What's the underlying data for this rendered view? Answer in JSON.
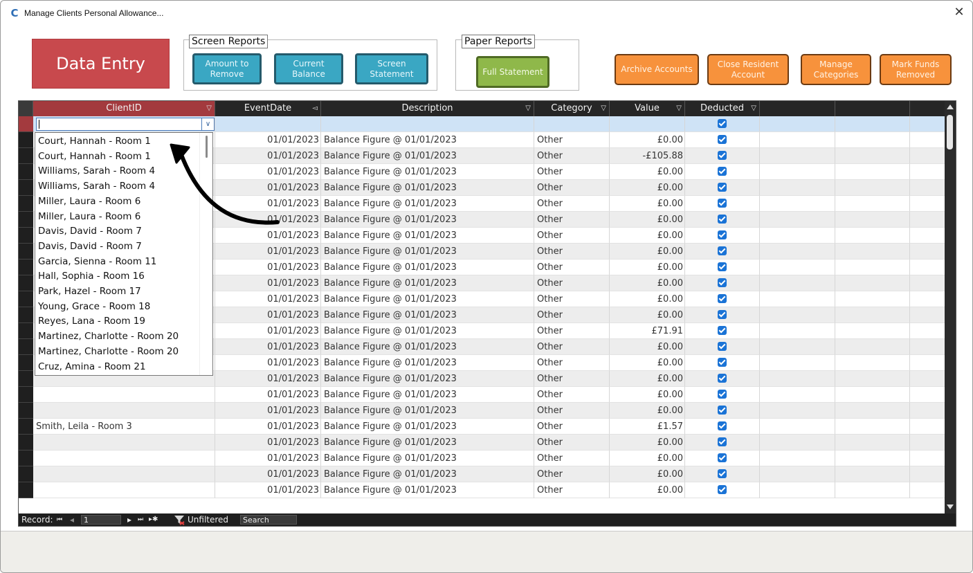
{
  "window": {
    "title": "Manage Clients Personal Allowance...",
    "close_glyph": "✕",
    "icon": "C"
  },
  "toolbar": {
    "data_entry": "Data Entry",
    "screen_reports_label": "Screen Reports",
    "amount_to_remove": "Amount to Remove",
    "current_balance": "Current Balance",
    "screen_statement": "Screen Statement",
    "paper_reports_label": "Paper Reports",
    "full_statement": "Full Statement",
    "archive_accounts": "Archive Accounts",
    "close_resident_account": "Close Resident Account",
    "manage_categories": "Manage Categories",
    "mark_funds_removed": "Mark Funds Removed"
  },
  "grid": {
    "columns": {
      "client": "ClientID",
      "date": "EventDate",
      "desc": "Description",
      "cat": "Category",
      "val": "Value",
      "ded": "Deducted"
    },
    "rows": [
      {
        "client": "",
        "date": "",
        "desc": "",
        "cat": "",
        "val": "",
        "ded": true
      },
      {
        "client": "",
        "date": "01/01/2023",
        "desc": "Balance Figure @ 01/01/2023",
        "cat": "Other",
        "val": "£0.00",
        "ded": true
      },
      {
        "client": "",
        "date": "01/01/2023",
        "desc": "Balance Figure @ 01/01/2023",
        "cat": "Other",
        "val": "-£105.88",
        "ded": true
      },
      {
        "client": "",
        "date": "01/01/2023",
        "desc": "Balance Figure @ 01/01/2023",
        "cat": "Other",
        "val": "£0.00",
        "ded": true
      },
      {
        "client": "",
        "date": "01/01/2023",
        "desc": "Balance Figure @ 01/01/2023",
        "cat": "Other",
        "val": "£0.00",
        "ded": true
      },
      {
        "client": "",
        "date": "01/01/2023",
        "desc": "Balance Figure @ 01/01/2023",
        "cat": "Other",
        "val": "£0.00",
        "ded": true
      },
      {
        "client": "",
        "date": "01/01/2023",
        "desc": "Balance Figure @ 01/01/2023",
        "cat": "Other",
        "val": "£0.00",
        "ded": true
      },
      {
        "client": "",
        "date": "01/01/2023",
        "desc": "Balance Figure @ 01/01/2023",
        "cat": "Other",
        "val": "£0.00",
        "ded": true
      },
      {
        "client": "",
        "date": "01/01/2023",
        "desc": "Balance Figure @ 01/01/2023",
        "cat": "Other",
        "val": "£0.00",
        "ded": true
      },
      {
        "client": "",
        "date": "01/01/2023",
        "desc": "Balance Figure @ 01/01/2023",
        "cat": "Other",
        "val": "£0.00",
        "ded": true
      },
      {
        "client": "",
        "date": "01/01/2023",
        "desc": "Balance Figure @ 01/01/2023",
        "cat": "Other",
        "val": "£0.00",
        "ded": true
      },
      {
        "client": "",
        "date": "01/01/2023",
        "desc": "Balance Figure @ 01/01/2023",
        "cat": "Other",
        "val": "£0.00",
        "ded": true
      },
      {
        "client": "",
        "date": "01/01/2023",
        "desc": "Balance Figure @ 01/01/2023",
        "cat": "Other",
        "val": "£0.00",
        "ded": true
      },
      {
        "client": "",
        "date": "01/01/2023",
        "desc": "Balance Figure @ 01/01/2023",
        "cat": "Other",
        "val": "£71.91",
        "ded": true
      },
      {
        "client": "",
        "date": "01/01/2023",
        "desc": "Balance Figure @ 01/01/2023",
        "cat": "Other",
        "val": "£0.00",
        "ded": true
      },
      {
        "client": "",
        "date": "01/01/2023",
        "desc": "Balance Figure @ 01/01/2023",
        "cat": "Other",
        "val": "£0.00",
        "ded": true
      },
      {
        "client": "",
        "date": "01/01/2023",
        "desc": "Balance Figure @ 01/01/2023",
        "cat": "Other",
        "val": "£0.00",
        "ded": true
      },
      {
        "client": "",
        "date": "01/01/2023",
        "desc": "Balance Figure @ 01/01/2023",
        "cat": "Other",
        "val": "£0.00",
        "ded": true
      },
      {
        "client": "",
        "date": "01/01/2023",
        "desc": "Balance Figure @ 01/01/2023",
        "cat": "Other",
        "val": "£0.00",
        "ded": true
      },
      {
        "client": "Smith, Leila - Room 3",
        "date": "01/01/2023",
        "desc": "Balance Figure @ 01/01/2023",
        "cat": "Other",
        "val": "£1.57",
        "ded": true
      },
      {
        "client": "",
        "date": "01/01/2023",
        "desc": "Balance Figure @ 01/01/2023",
        "cat": "Other",
        "val": "£0.00",
        "ded": true
      },
      {
        "client": "",
        "date": "01/01/2023",
        "desc": "Balance Figure @ 01/01/2023",
        "cat": "Other",
        "val": "£0.00",
        "ded": true
      },
      {
        "client": "",
        "date": "01/01/2023",
        "desc": "Balance Figure @ 01/01/2023",
        "cat": "Other",
        "val": "£0.00",
        "ded": true
      },
      {
        "client": "",
        "date": "01/01/2023",
        "desc": "Balance Figure @ 01/01/2023",
        "cat": "Other",
        "val": "£0.00",
        "ded": true
      }
    ]
  },
  "dropdown": {
    "items": [
      "Court, Hannah - Room 1",
      "Court, Hannah - Room 1",
      "Williams, Sarah - Room 4",
      "Williams, Sarah - Room 4",
      "Miller, Laura - Room 6",
      "Miller, Laura - Room 6",
      "Davis, David - Room 7",
      "Davis, David - Room 7",
      "Garcia, Sienna - Room 11",
      "Hall, Sophia - Room 16",
      "Park, Hazel - Room 17",
      "Young, Grace - Room 18",
      "Reyes, Lana - Room 19",
      "Martinez, Charlotte - Room 20",
      "Martinez, Charlotte - Room 20",
      "Cruz, Amina - Room 21"
    ]
  },
  "navbar": {
    "record_label": "Record:",
    "first": "⏮",
    "prev": "◂",
    "record_value": "1",
    "next": "▸",
    "last": "⏭",
    "new": "▸✱",
    "filter": "Unfiltered",
    "search": "Search"
  },
  "colors": {
    "data_entry": "#c8494d",
    "screen_buttons": "#3aa7c3",
    "paper_button": "#8fb84a",
    "action_buttons": "#f7923c",
    "checkbox": "#1a73d6"
  }
}
